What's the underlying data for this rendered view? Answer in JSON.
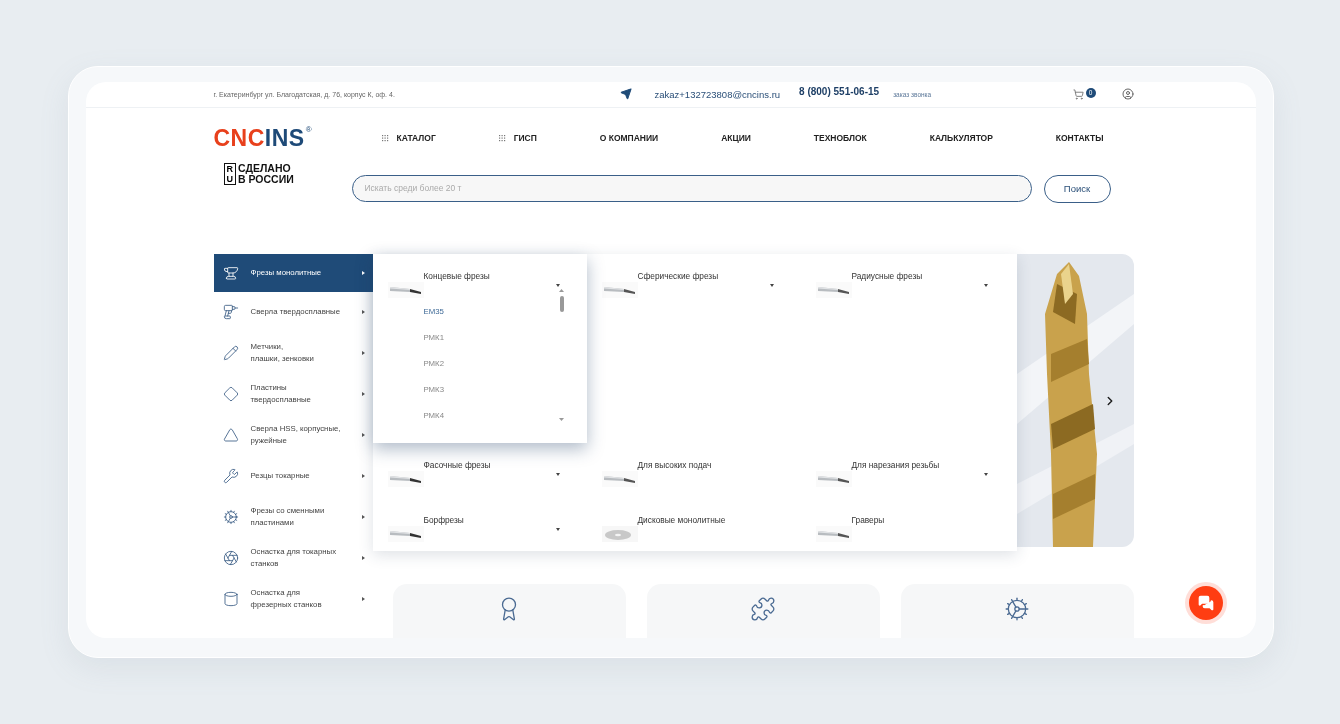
{
  "top_bar": {
    "address": "г. Екатеринбург ул. Благодатская, д. 76, корпус К, оф. 4.",
    "email": "zakaz+132723808@cncins.ru",
    "phone": "8 (800) 551-06-15",
    "callback": "заказ звонка",
    "cart_count": "0"
  },
  "logo": {
    "parts": [
      {
        "text": "CNC",
        "color": "#e8401c"
      },
      {
        "text": "INS",
        "color": "#1e4a78"
      }
    ],
    "mark": "®"
  },
  "badge": {
    "letters": [
      "R",
      "U"
    ],
    "lines": [
      "СДЕЛАНО",
      "В РОССИИ"
    ]
  },
  "nav": [
    {
      "label": "КАТАЛОГ",
      "kind": "menu"
    },
    {
      "label": "ГИСП",
      "kind": "menu"
    },
    {
      "label": "О КОМПАНИИ",
      "kind": "link"
    },
    {
      "label": "АКЦИИ",
      "kind": "link"
    },
    {
      "label": "ТЕХНОБЛОК",
      "kind": "link"
    },
    {
      "label": "КАЛЬКУЛЯТОР",
      "kind": "link"
    },
    {
      "label": "КОНТАКТЫ",
      "kind": "link"
    }
  ],
  "search": {
    "placeholder": "Искать среди более 20 т",
    "button": "Поиск"
  },
  "sidebar": {
    "items": [
      {
        "lines": [
          "Фрезы монолитные"
        ],
        "selected": true
      },
      {
        "lines": [
          "Сверла твердосплавные"
        ],
        "selected": false
      },
      {
        "lines": [
          "Метчики,",
          "плашки, зенковки"
        ],
        "selected": false
      },
      {
        "lines": [
          "Пластины",
          "твердосплавные"
        ],
        "selected": false
      },
      {
        "lines": [
          "Сверла HSS, корпусные,",
          "ружейные"
        ],
        "selected": false
      },
      {
        "lines": [
          "Резцы токарные"
        ],
        "selected": false
      },
      {
        "lines": [
          "Фрезы со сменными",
          "пластинами"
        ],
        "selected": false
      },
      {
        "lines": [
          "Оснастка для токарных",
          "станков"
        ],
        "selected": false
      },
      {
        "lines": [
          "Оснастка для",
          "фрезерных станков"
        ],
        "selected": false
      }
    ]
  },
  "categories": [
    {
      "title": "Концевые фрезы",
      "expandable": true,
      "expanded": true,
      "items": [
        {
          "label": "EM35",
          "selected": true
        },
        {
          "label": "РМК1",
          "selected": false
        },
        {
          "label": "РМК2",
          "selected": false
        },
        {
          "label": "РМК3",
          "selected": false
        },
        {
          "label": "РМК4",
          "selected": false
        }
      ]
    },
    {
      "title": "Сферические фрезы",
      "expandable": true,
      "expanded": false
    },
    {
      "title": "Радиусные фрезы",
      "expandable": true,
      "expanded": false
    },
    {
      "title": "Фасочные фрезы",
      "expandable": true,
      "expanded": false
    },
    {
      "title": "Для высоких подач",
      "expandable": false,
      "expanded": false
    },
    {
      "title": "Для нарезания резьбы",
      "expandable": true,
      "expanded": false
    },
    {
      "title": "Борфрезы",
      "expandable": true,
      "expanded": false
    },
    {
      "title": "Дисковые монолитные",
      "expandable": false,
      "expanded": false
    },
    {
      "title": "Граверы",
      "expandable": false,
      "expanded": false
    }
  ],
  "feature_cards": [
    {
      "kind": "certificate"
    },
    {
      "kind": "puzzle"
    },
    {
      "kind": "gear"
    }
  ]
}
